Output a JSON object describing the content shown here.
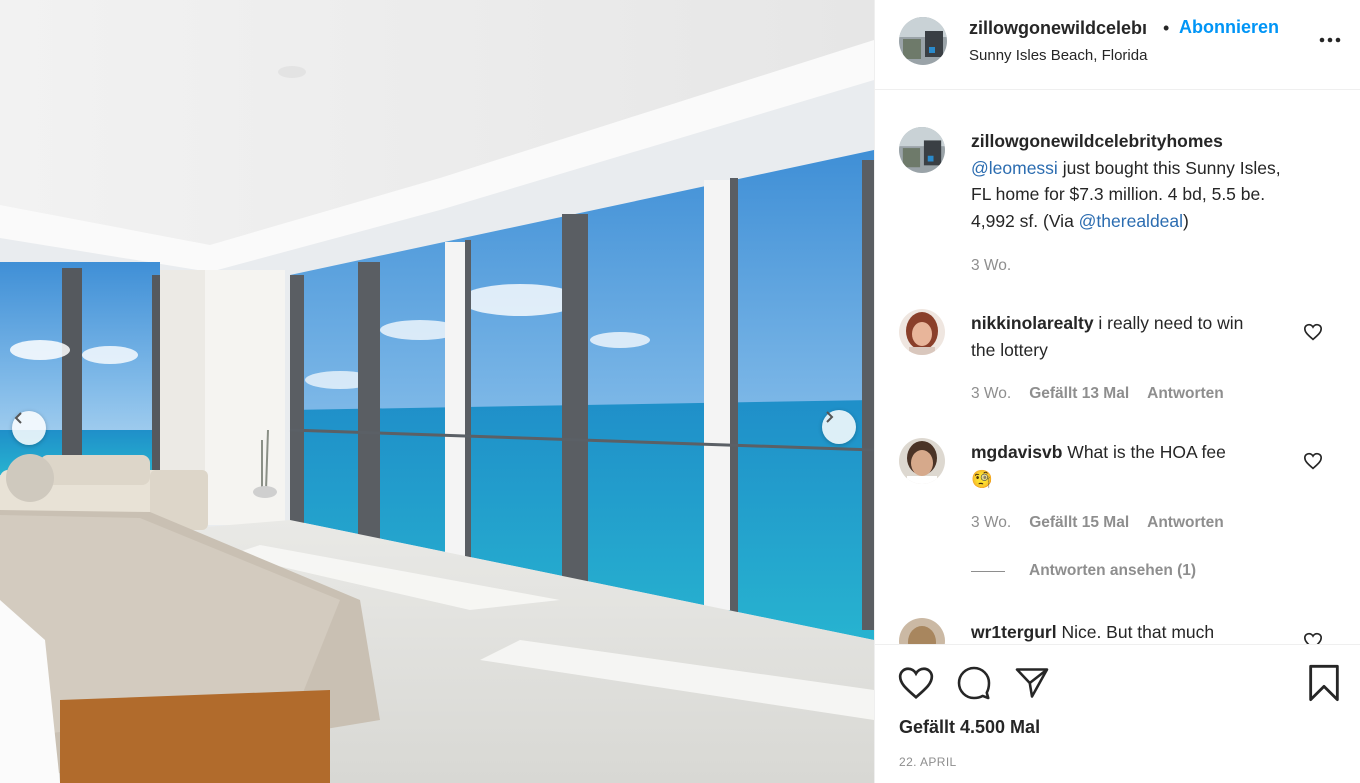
{
  "post": {
    "username_truncated": "zillowgonewildcelebı",
    "dot": "•",
    "follow_label": "Abonnieren",
    "location": "Sunny Isles Beach, Florida"
  },
  "caption": {
    "username": "zillowgonewildcelebrityhomes",
    "mention1": "@leomessi",
    "text_part1": " just bought this Sunny Isles, FL home for $7.3 million. 4 bd, 5.5 be. 4,992 sf. (Via ",
    "mention2": "@therealdeal",
    "text_part2": ")",
    "time": "3 Wo."
  },
  "comments": [
    {
      "username": "nikkinolarealty",
      "text": " i really need to win the lottery",
      "time": "3 Wo.",
      "likes": "Gefällt 13 Mal",
      "reply_label": "Antworten"
    },
    {
      "username": "mgdavisvb",
      "text": " What is the HOA fee",
      "emoji": "🧐",
      "time": "3 Wo.",
      "likes": "Gefällt 15 Mal",
      "reply_label": "Antworten",
      "view_replies": "Antworten ansehen (1)"
    },
    {
      "username": "wr1tergurl",
      "text": " Nice. But that much"
    }
  ],
  "footer": {
    "likes": "Gefällt 4.500 Mal",
    "date": "22. APRIL"
  },
  "icons": {
    "more": "more-options-icon",
    "like": "heart-icon",
    "comment": "comment-icon",
    "share": "paper-plane-icon",
    "save": "bookmark-icon",
    "prev": "chevron-left-icon",
    "next": "chevron-right-icon"
  },
  "colors": {
    "link_blue": "#0095f6",
    "text": "#262626",
    "muted": "#8e8e8e",
    "divider": "#efefef"
  }
}
